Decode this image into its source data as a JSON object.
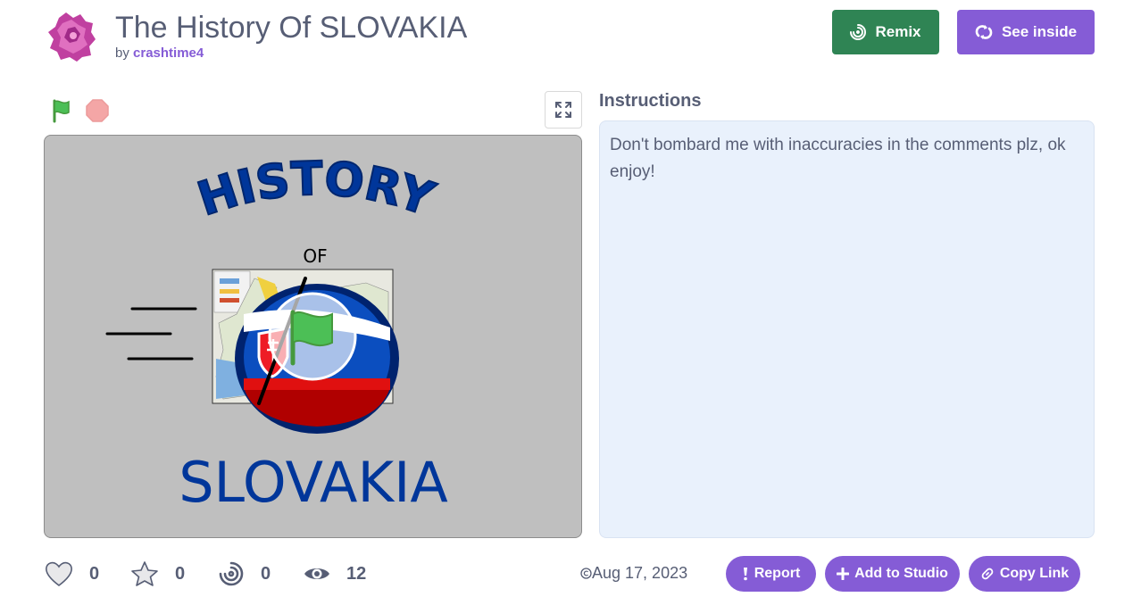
{
  "project": {
    "title": "The History Of SLOVAKIA",
    "by_prefix": "by",
    "author": "crashtime4"
  },
  "header_buttons": {
    "remix_label": "Remix",
    "see_inside_label": "See inside"
  },
  "player": {
    "green_flag_icon": "green-flag-icon",
    "stop_icon": "stop-sign-icon",
    "fullscreen_icon": "fullscreen-icon",
    "stage_text": {
      "history": "HISTORY",
      "of": "OF",
      "country": "SLOVAKIA"
    }
  },
  "instructions": {
    "heading": "Instructions",
    "text": "Don't bombard me with inaccuracies in the comments plz, ok enjoy!"
  },
  "stats": {
    "loves": "0",
    "favorites": "0",
    "remixes": "0",
    "views": "12"
  },
  "shared_date": "Aug 17, 2023",
  "actions": {
    "report_label": "Report",
    "add_to_studio_label": "Add to Studio",
    "copy_link_label": "Copy Link"
  },
  "colors": {
    "remix_green": "#2f8454",
    "accent_purple": "#855cd6",
    "text_gray": "#575e75",
    "instructions_bg": "#e9f1fc",
    "stage_bg": "#bfbfbf"
  }
}
